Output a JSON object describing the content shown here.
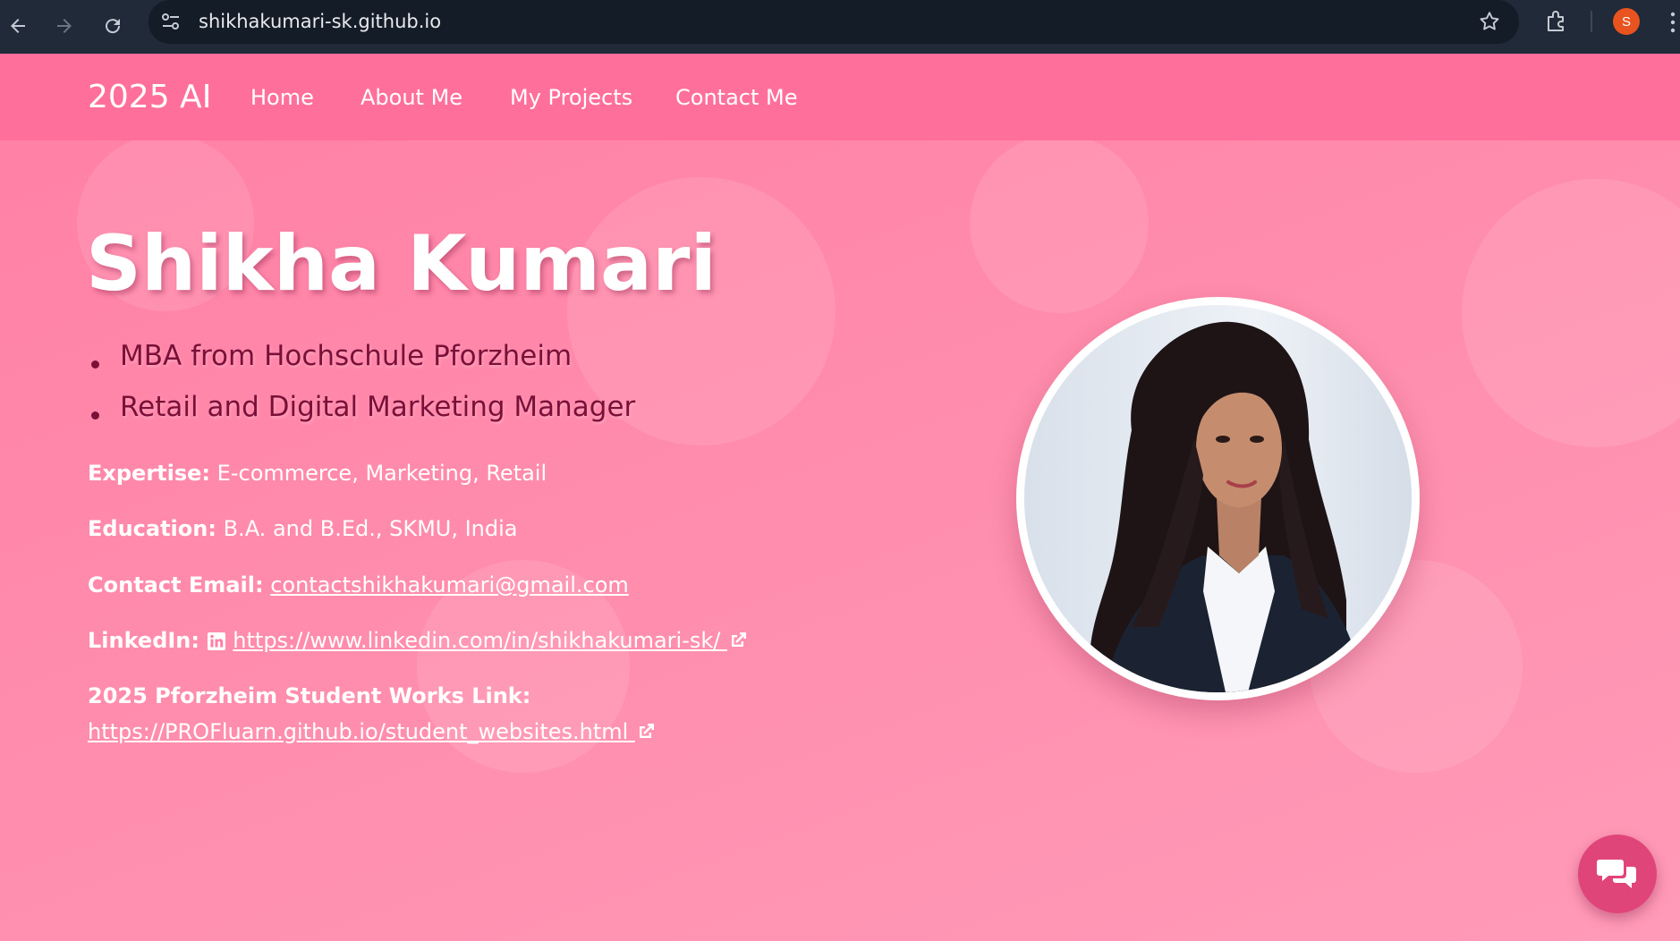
{
  "browser": {
    "url": "shikhakumari-sk.github.io",
    "profile_initial": "S"
  },
  "nav": {
    "brand": "2025 AI",
    "links": [
      "Home",
      "About Me",
      "My Projects",
      "Contact Me"
    ]
  },
  "hero": {
    "name": "Shikha Kumari",
    "bullets": [
      "MBA from Hochschule Pforzheim",
      "Retail and Digital Marketing Manager"
    ],
    "expertise_label": "Expertise:",
    "expertise_value": "E-commerce, Marketing, Retail",
    "education_label": "Education:",
    "education_value": "B.A. and B.Ed., SKMU, India",
    "email_label": "Contact Email:",
    "email_value": "contactshikhakumari@gmail.com",
    "linkedin_label": "LinkedIn:",
    "linkedin_value": " https://www.linkedin.com/in/shikhakumari-sk/ ",
    "student_works_label": "2025 Pforzheim Student Works Link:",
    "student_works_value": "https://PROFluarn.github.io/student_websites.html "
  },
  "colors": {
    "page_bg": "#ff8cac",
    "nav_bg": "#ff6f9c",
    "bullet_text": "#7a1038",
    "chat_button": "#e0457a"
  },
  "icons": {
    "chrome": [
      "back-arrow-icon",
      "forward-arrow-icon",
      "reload-icon",
      "site-settings-icon",
      "star-icon",
      "extensions-icon",
      "more-menu-icon"
    ],
    "page": [
      "linkedin-icon",
      "external-link-icon",
      "chat-icon"
    ]
  }
}
